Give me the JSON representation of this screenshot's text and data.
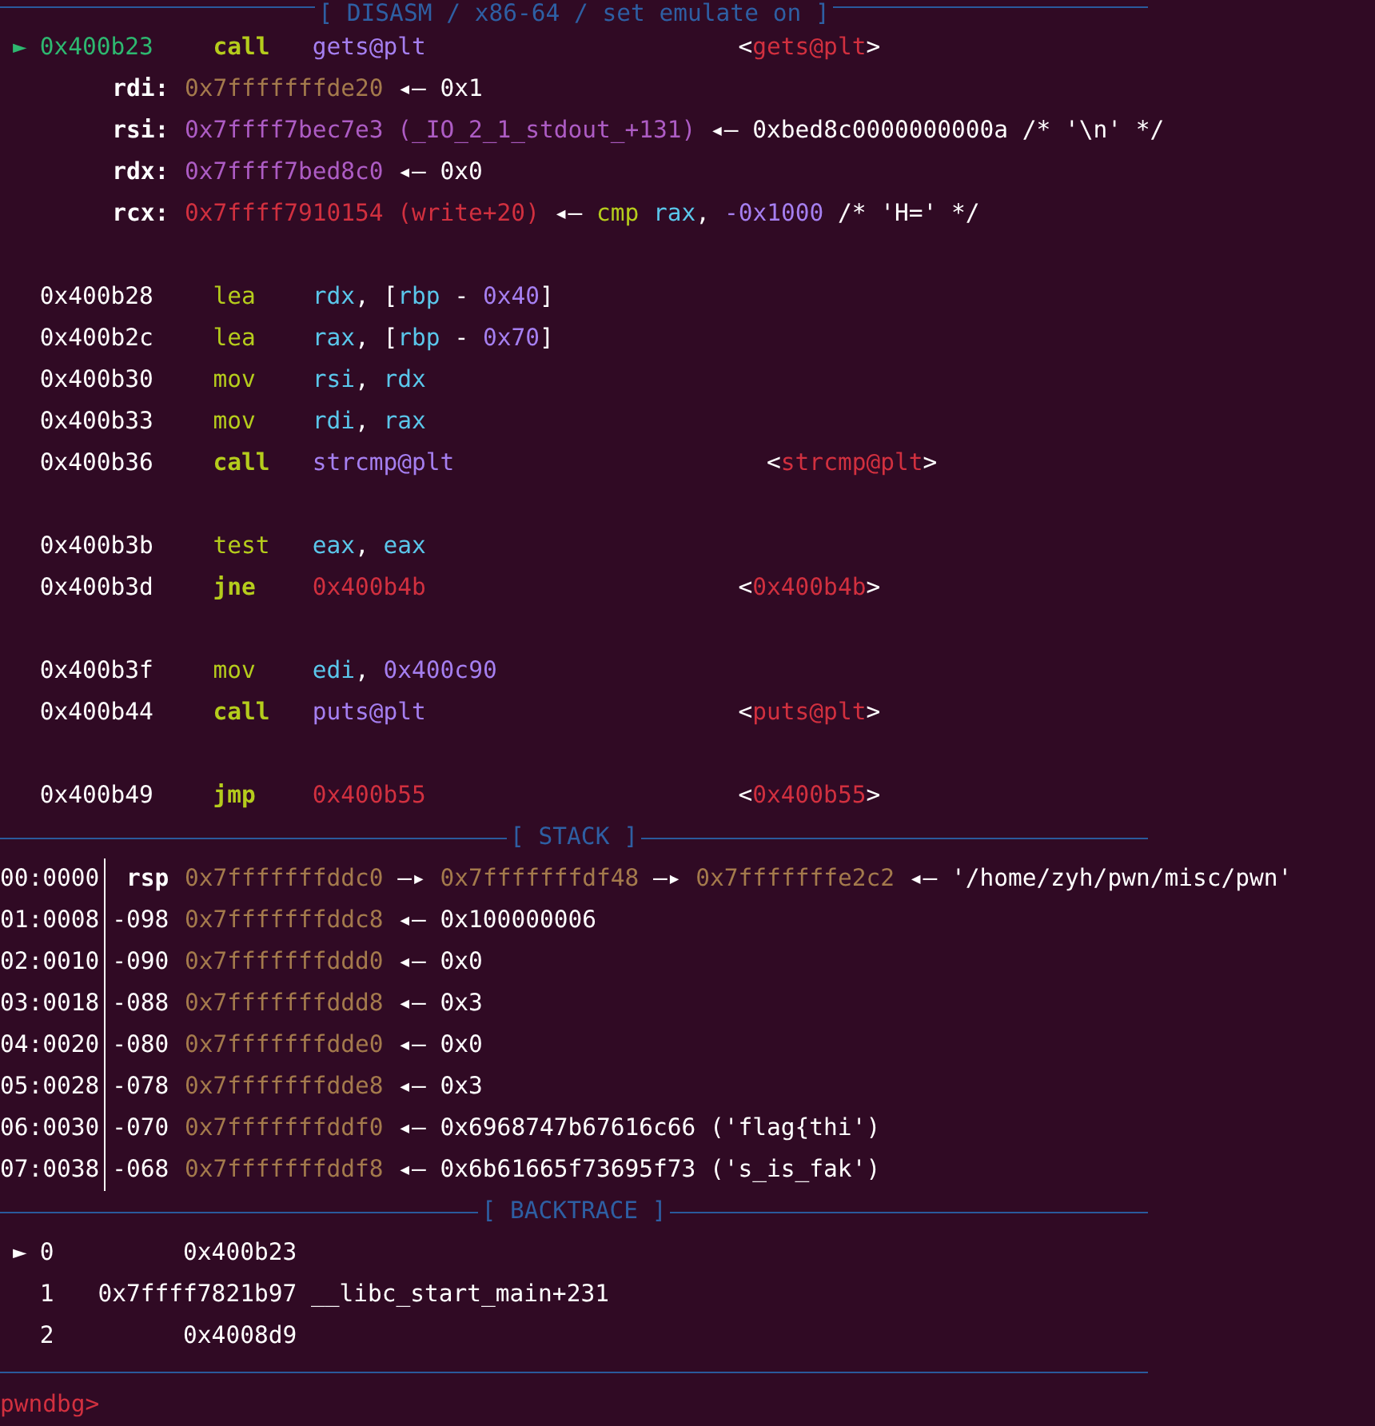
{
  "disasm": {
    "title": "[ DISASM / x86-64 / set emulate on ]",
    "marker": "►",
    "lines": [
      {
        "kind": "instr",
        "current": true,
        "address": "0x400b23",
        "mnemonic": "call",
        "branch": true,
        "operands": [
          {
            "text": "gets@plt",
            "kind": "num"
          }
        ],
        "target": [
          {
            "text": "<",
            "kind": "plain"
          },
          {
            "text": "gets@plt",
            "kind": "code"
          },
          {
            "text": ">",
            "kind": "plain"
          }
        ]
      },
      {
        "kind": "register",
        "name": "rdi:",
        "value": [
          {
            "text": "0x7fffffffde20",
            "kind": "stack"
          },
          {
            "text": " ◂— 0x1",
            "kind": "plain"
          }
        ]
      },
      {
        "kind": "register",
        "name": "rsi:",
        "value": [
          {
            "text": "0x7ffff7bec7e3 (_IO_2_1_stdout_+131)",
            "kind": "lib"
          },
          {
            "text": " ◂— 0xbed8c0000000000a /* '\\n' */",
            "kind": "plain"
          }
        ]
      },
      {
        "kind": "register",
        "name": "rdx:",
        "value": [
          {
            "text": "0x7ffff7bed8c0",
            "kind": "lib"
          },
          {
            "text": " ◂— 0x0",
            "kind": "plain"
          }
        ]
      },
      {
        "kind": "register",
        "name": "rcx:",
        "value": [
          {
            "text": "0x7ffff7910154 (write+20)",
            "kind": "code"
          },
          {
            "text": " ◂— ",
            "kind": "plain"
          },
          {
            "text": "cmp",
            "kind": "mnem"
          },
          {
            "text": " rax",
            "kind": "reg"
          },
          {
            "text": ", ",
            "kind": "plain"
          },
          {
            "text": "-0x1000",
            "kind": "num"
          },
          {
            "text": " /* 'H=' */",
            "kind": "plain"
          }
        ]
      },
      {
        "kind": "blank"
      },
      {
        "kind": "instr",
        "current": false,
        "address": "0x400b28",
        "mnemonic": "lea",
        "branch": false,
        "operands": [
          {
            "text": "rdx",
            "kind": "reg"
          },
          {
            "text": ", [",
            "kind": "plain"
          },
          {
            "text": "rbp",
            "kind": "reg"
          },
          {
            "text": " - ",
            "kind": "plain"
          },
          {
            "text": "0x40",
            "kind": "num"
          },
          {
            "text": "]",
            "kind": "plain"
          }
        ]
      },
      {
        "kind": "instr",
        "current": false,
        "address": "0x400b2c",
        "mnemonic": "lea",
        "branch": false,
        "operands": [
          {
            "text": "rax",
            "kind": "reg"
          },
          {
            "text": ", [",
            "kind": "plain"
          },
          {
            "text": "rbp",
            "kind": "reg"
          },
          {
            "text": " - ",
            "kind": "plain"
          },
          {
            "text": "0x70",
            "kind": "num"
          },
          {
            "text": "]",
            "kind": "plain"
          }
        ]
      },
      {
        "kind": "instr",
        "current": false,
        "address": "0x400b30",
        "mnemonic": "mov",
        "branch": false,
        "operands": [
          {
            "text": "rsi",
            "kind": "reg"
          },
          {
            "text": ", ",
            "kind": "plain"
          },
          {
            "text": "rdx",
            "kind": "reg"
          }
        ]
      },
      {
        "kind": "instr",
        "current": false,
        "address": "0x400b33",
        "mnemonic": "mov",
        "branch": false,
        "operands": [
          {
            "text": "rdi",
            "kind": "reg"
          },
          {
            "text": ", ",
            "kind": "plain"
          },
          {
            "text": "rax",
            "kind": "reg"
          }
        ]
      },
      {
        "kind": "instr",
        "current": false,
        "address": "0x400b36",
        "mnemonic": "call",
        "branch": true,
        "operands": [
          {
            "text": "strcmp@plt",
            "kind": "num"
          }
        ],
        "target": [
          {
            "text": "<",
            "kind": "plain"
          },
          {
            "text": "strcmp@plt",
            "kind": "code"
          },
          {
            "text": ">",
            "kind": "plain"
          }
        ]
      },
      {
        "kind": "blank"
      },
      {
        "kind": "instr",
        "current": false,
        "address": "0x400b3b",
        "mnemonic": "test",
        "branch": false,
        "operands": [
          {
            "text": "eax",
            "kind": "reg"
          },
          {
            "text": ", ",
            "kind": "plain"
          },
          {
            "text": "eax",
            "kind": "reg"
          }
        ]
      },
      {
        "kind": "instr",
        "current": false,
        "address": "0x400b3d",
        "mnemonic": "jne",
        "branch": true,
        "operands": [
          {
            "text": "0x400b4b",
            "kind": "code"
          }
        ],
        "target": [
          {
            "text": "<",
            "kind": "plain"
          },
          {
            "text": "0x400b4b",
            "kind": "code"
          },
          {
            "text": ">",
            "kind": "plain"
          }
        ]
      },
      {
        "kind": "blank"
      },
      {
        "kind": "instr",
        "current": false,
        "address": "0x400b3f",
        "mnemonic": "mov",
        "branch": false,
        "operands": [
          {
            "text": "edi",
            "kind": "reg"
          },
          {
            "text": ", ",
            "kind": "plain"
          },
          {
            "text": "0x400c90",
            "kind": "num"
          }
        ]
      },
      {
        "kind": "instr",
        "current": false,
        "address": "0x400b44",
        "mnemonic": "call",
        "branch": true,
        "operands": [
          {
            "text": "puts@plt",
            "kind": "num"
          }
        ],
        "target": [
          {
            "text": "<",
            "kind": "plain"
          },
          {
            "text": "puts@plt",
            "kind": "code"
          },
          {
            "text": ">",
            "kind": "plain"
          }
        ]
      },
      {
        "kind": "blank"
      },
      {
        "kind": "instr",
        "current": false,
        "address": "0x400b49",
        "mnemonic": "jmp",
        "branch": true,
        "operands": [
          {
            "text": "0x400b55",
            "kind": "code"
          }
        ],
        "target": [
          {
            "text": "<",
            "kind": "plain"
          },
          {
            "text": "0x400b55",
            "kind": "code"
          },
          {
            "text": ">",
            "kind": "plain"
          }
        ]
      }
    ]
  },
  "stack": {
    "title": "[ STACK ]",
    "rows": [
      {
        "offset": "00:0000",
        "label": "rsp",
        "kind": "register",
        "value": [
          {
            "text": "0x7fffffffddc0",
            "kind": "stack"
          },
          {
            "text": " —▸ ",
            "kind": "plain"
          },
          {
            "text": "0x7fffffffdf48",
            "kind": "stack"
          },
          {
            "text": " —▸ ",
            "kind": "plain"
          },
          {
            "text": "0x7fffffffe2c2",
            "kind": "stack"
          },
          {
            "text": " ◂— '/home/zyh/pwn/misc/pwn'",
            "kind": "plain"
          }
        ]
      },
      {
        "offset": "01:0008",
        "label": "-098",
        "kind": "offset",
        "value": [
          {
            "text": "0x7fffffffddc8",
            "kind": "stack"
          },
          {
            "text": " ◂— 0x100000006",
            "kind": "plain"
          }
        ]
      },
      {
        "offset": "02:0010",
        "label": "-090",
        "kind": "offset",
        "value": [
          {
            "text": "0x7fffffffddd0",
            "kind": "stack"
          },
          {
            "text": " ◂— 0x0",
            "kind": "plain"
          }
        ]
      },
      {
        "offset": "03:0018",
        "label": "-088",
        "kind": "offset",
        "value": [
          {
            "text": "0x7fffffffddd8",
            "kind": "stack"
          },
          {
            "text": " ◂— 0x3",
            "kind": "plain"
          }
        ]
      },
      {
        "offset": "04:0020",
        "label": "-080",
        "kind": "offset",
        "value": [
          {
            "text": "0x7fffffffdde0",
            "kind": "stack"
          },
          {
            "text": " ◂— 0x0",
            "kind": "plain"
          }
        ]
      },
      {
        "offset": "05:0028",
        "label": "-078",
        "kind": "offset",
        "value": [
          {
            "text": "0x7fffffffdde8",
            "kind": "stack"
          },
          {
            "text": " ◂— 0x3",
            "kind": "plain"
          }
        ]
      },
      {
        "offset": "06:0030",
        "label": "-070",
        "kind": "offset",
        "value": [
          {
            "text": "0x7fffffffddf0",
            "kind": "stack"
          },
          {
            "text": " ◂— 0x6968747b67616c66 ('flag{thi')",
            "kind": "plain"
          }
        ]
      },
      {
        "offset": "07:0038",
        "label": "-068",
        "kind": "offset",
        "value": [
          {
            "text": "0x7fffffffddf8",
            "kind": "stack"
          },
          {
            "text": " ◂— 0x6b61665f73695f73 ('s_is_fak')",
            "kind": "plain"
          }
        ]
      }
    ]
  },
  "backtrace": {
    "title": "[ BACKTRACE ]",
    "marker": "►",
    "frames": [
      {
        "selected": true,
        "index": "0",
        "address": "0x400b23"
      },
      {
        "selected": false,
        "index": "1",
        "address": "0x7ffff7821b97",
        "symbol": "__libc_start_main+231"
      },
      {
        "selected": false,
        "index": "2",
        "address": "0x4008d9"
      }
    ]
  },
  "prompt": "pwndbg>"
}
